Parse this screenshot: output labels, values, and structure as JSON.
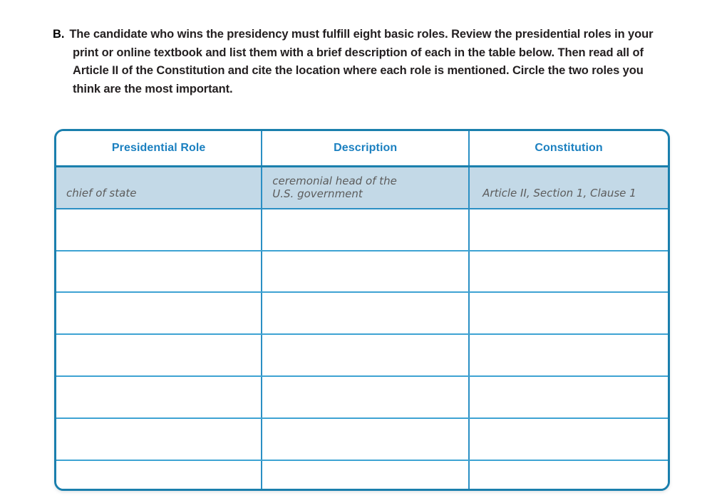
{
  "instructions": {
    "label": "B.",
    "text": "The candidate who wins the presidency must fulfill eight basic roles. Review the presidential roles in your print or online textbook and list them with a brief description of each in the table below. Then read all of Article II of the Constitution and cite the location where each role is mentioned. Circle the two roles you think are the most important."
  },
  "table": {
    "headers": {
      "col1": "Presidential Role",
      "col2": "Description",
      "col3": "Constitution"
    },
    "rows": [
      {
        "filled": true,
        "role": "chief of state",
        "description_line1": "ceremonial head of the",
        "description_line2": "U.S. government",
        "constitution": "Article II, Section 1, Clause 1"
      },
      {
        "filled": false,
        "role": "",
        "description_line1": "",
        "description_line2": "",
        "constitution": ""
      },
      {
        "filled": false,
        "role": "",
        "description_line1": "",
        "description_line2": "",
        "constitution": ""
      },
      {
        "filled": false,
        "role": "",
        "description_line1": "",
        "description_line2": "",
        "constitution": ""
      },
      {
        "filled": false,
        "role": "",
        "description_line1": "",
        "description_line2": "",
        "constitution": ""
      },
      {
        "filled": false,
        "role": "",
        "description_line1": "",
        "description_line2": "",
        "constitution": ""
      },
      {
        "filled": false,
        "role": "",
        "description_line1": "",
        "description_line2": "",
        "constitution": ""
      },
      {
        "filled": false,
        "role": "",
        "description_line1": "",
        "description_line2": "",
        "constitution": ""
      }
    ]
  },
  "colors": {
    "outer_border": "#1a7fad",
    "inner_border": "#3ea3d3",
    "header_text": "#1b80c0",
    "filled_row_bg": "#c3d9e7",
    "handwriting_text": "#5c5c5c",
    "body_text": "#231f20"
  }
}
